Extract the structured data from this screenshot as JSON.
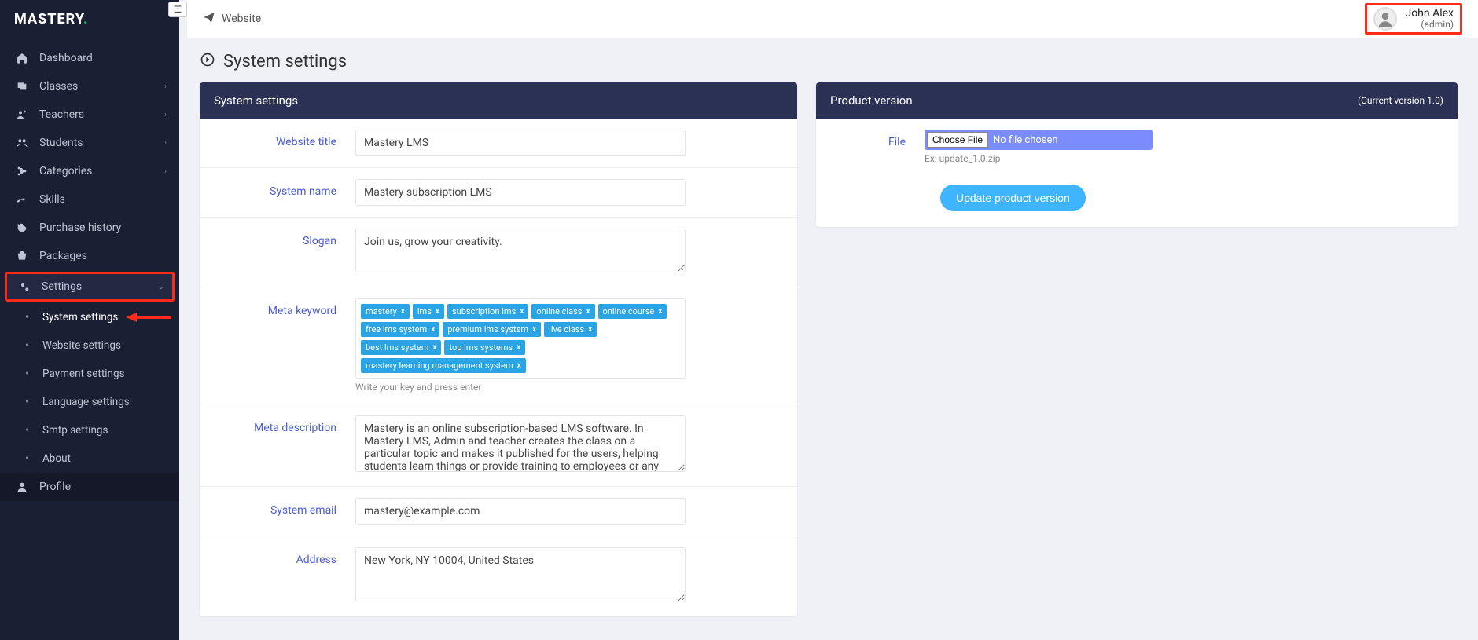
{
  "brand": {
    "name": "MASTERY",
    "dot": "."
  },
  "sidebar": {
    "items": [
      {
        "icon": "home",
        "label": "Dashboard",
        "chev": false
      },
      {
        "icon": "classes",
        "label": "Classes",
        "chev": true
      },
      {
        "icon": "teachers",
        "label": "Teachers",
        "chev": true
      },
      {
        "icon": "students",
        "label": "Students",
        "chev": true
      },
      {
        "icon": "categories",
        "label": "Categories",
        "chev": true
      },
      {
        "icon": "skills",
        "label": "Skills",
        "chev": false
      },
      {
        "icon": "history",
        "label": "Purchase history",
        "chev": false
      },
      {
        "icon": "packages",
        "label": "Packages",
        "chev": false
      }
    ],
    "settings_label": "Settings",
    "settings_sub": [
      "System settings",
      "Website settings",
      "Payment settings",
      "Language settings",
      "Smtp settings",
      "About"
    ],
    "profile_label": "Profile"
  },
  "topbar": {
    "website_label": "Website",
    "user_name": "John Alex",
    "user_role": "(admin)"
  },
  "page": {
    "title": "System settings"
  },
  "settings_card": {
    "header": "System settings",
    "fields": {
      "website_title": {
        "label": "Website title",
        "value": "Mastery LMS"
      },
      "system_name": {
        "label": "System name",
        "value": "Mastery subscription LMS"
      },
      "slogan": {
        "label": "Slogan",
        "value": "Join us, grow your creativity."
      },
      "meta_keyword": {
        "label": "Meta keyword",
        "tags": [
          "mastery",
          "lms",
          "subscription lms",
          "online class",
          "online course",
          "free lms system",
          "premium lms system",
          "live class",
          "best lms system",
          "top lms systems",
          "mastery learning management system"
        ],
        "help": "Write your key and press enter"
      },
      "meta_description": {
        "label": "Meta description",
        "value": "Mastery is an online subscription-based LMS software. In Mastery LMS, Admin and teacher creates the class on a particular topic and makes it published for the users, helping students learn things or provide training to employees or any users."
      },
      "system_email": {
        "label": "System email",
        "value": "mastery@example.com"
      },
      "address": {
        "label": "Address",
        "value": "New York, NY 10004, United States"
      }
    }
  },
  "version_card": {
    "header": "Product version",
    "current": "(Current version 1.0)",
    "file_label": "File",
    "choose_label": "Choose File",
    "no_file": "No file chosen",
    "example": "Ex: update_1.0.zip",
    "update_btn": "Update product version"
  }
}
